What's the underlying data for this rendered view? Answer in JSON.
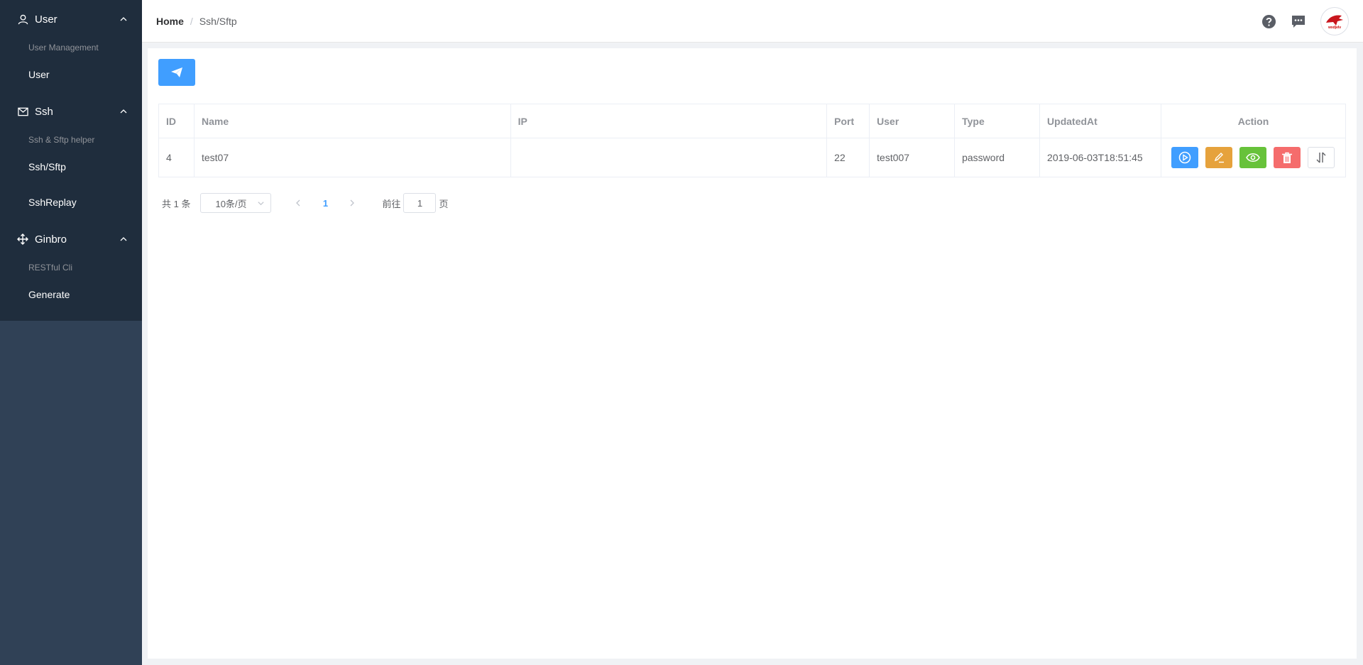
{
  "sidebar": {
    "groups": [
      {
        "title": "User",
        "icon": "user-icon",
        "label": "User Management",
        "items": [
          {
            "label": "User"
          }
        ]
      },
      {
        "title": "Ssh",
        "icon": "mail-icon",
        "label": "Ssh & Sftp helper",
        "items": [
          {
            "label": "Ssh/Sftp"
          },
          {
            "label": "SshReplay"
          }
        ]
      },
      {
        "title": "Ginbro",
        "icon": "rank-icon",
        "label": "RESTful Cli",
        "items": [
          {
            "label": "Generate"
          }
        ]
      }
    ]
  },
  "header": {
    "breadcrumb": {
      "home": "Home",
      "separator": "/",
      "current": "Ssh/Sftp"
    },
    "avatar_text": "wxdjelv"
  },
  "table": {
    "columns": [
      "ID",
      "Name",
      "IP",
      "Port",
      "User",
      "Type",
      "UpdatedAt",
      "Action"
    ],
    "rows": [
      {
        "id": "4",
        "name": "test07",
        "ip": "",
        "port": "22",
        "user": "test007",
        "type": "password",
        "updated_at": "2019-06-03T18:51:45"
      }
    ]
  },
  "pagination": {
    "total": "共 1 条",
    "page_size": "10条/页",
    "current_page": "1",
    "goto_label": "前往",
    "goto_value": "1",
    "goto_suffix": "页"
  },
  "colors": {
    "sidebar_bg": "#304156",
    "menu_bg": "#1f2d3d",
    "primary": "#409eff",
    "warning": "#e6a23c",
    "success": "#67c23a",
    "danger": "#f56c6c"
  }
}
